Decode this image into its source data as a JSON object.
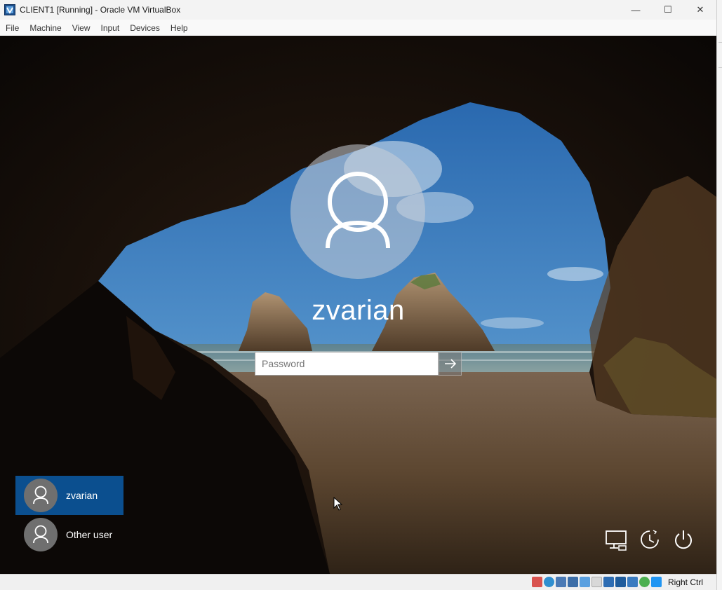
{
  "window": {
    "title": "CLIENT1 [Running] - Oracle VM VirtualBox",
    "controls": {
      "minimize": "—",
      "maximize": "☐",
      "close": "✕"
    }
  },
  "menu": [
    "File",
    "Machine",
    "View",
    "Input",
    "Devices",
    "Help"
  ],
  "login": {
    "username": "zvarian",
    "password_placeholder": "Password",
    "users": [
      "zvarian",
      "Other user"
    ]
  },
  "status": {
    "host_key": "Right Ctrl"
  },
  "colors": {
    "accent": "#0b4f8f",
    "titlebar": "#f3f3f3"
  }
}
